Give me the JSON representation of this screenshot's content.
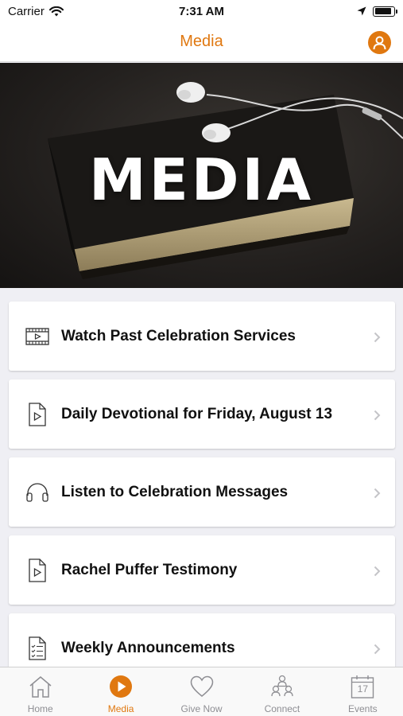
{
  "status_bar": {
    "carrier": "Carrier",
    "time": "7:31 AM",
    "battery_level": 0.9
  },
  "nav": {
    "title": "Media"
  },
  "hero": {
    "title": "MEDIA"
  },
  "items": [
    {
      "label": "Watch Past Celebration Services",
      "icon": "film-icon"
    },
    {
      "label": "Daily Devotional for Friday, August 13",
      "icon": "video-file-icon"
    },
    {
      "label": "Listen to Celebration Messages",
      "icon": "headphones-icon"
    },
    {
      "label": "Rachel Puffer Testimony",
      "icon": "video-file-icon"
    },
    {
      "label": "Weekly Announcements",
      "icon": "checklist-document-icon"
    }
  ],
  "tabs": [
    {
      "label": "Home",
      "icon": "home-icon",
      "active": false
    },
    {
      "label": "Media",
      "icon": "play-circle-icon",
      "active": true
    },
    {
      "label": "Give Now",
      "icon": "heart-icon",
      "active": false
    },
    {
      "label": "Connect",
      "icon": "people-icon",
      "active": false
    },
    {
      "label": "Events",
      "icon": "calendar-icon",
      "active": false,
      "calendar_day": "17"
    }
  ],
  "colors": {
    "accent": "#e07810",
    "inactive": "#8e8e93",
    "background": "#efeff4"
  }
}
